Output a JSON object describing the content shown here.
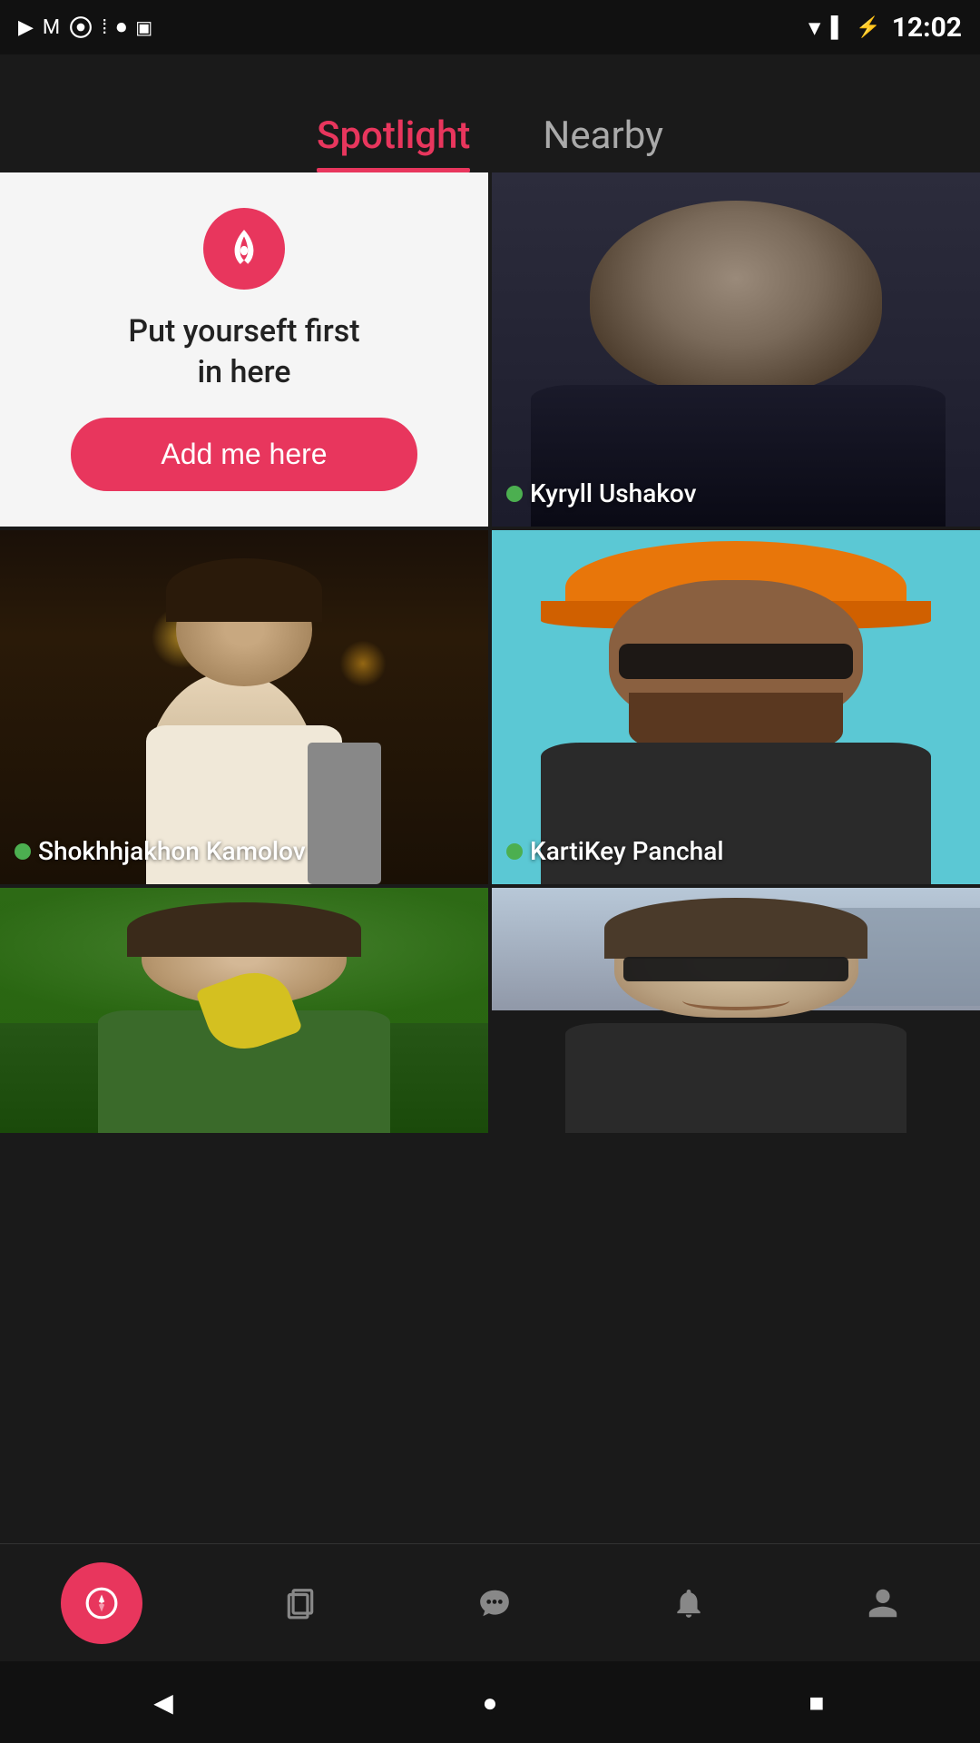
{
  "statusBar": {
    "time": "12:02",
    "icons": [
      "play-icon",
      "gmail-icon",
      "chrome-icon",
      "dots-icon",
      "record-icon",
      "nfc-icon"
    ]
  },
  "tabs": [
    {
      "id": "spotlight",
      "label": "Spotlight",
      "active": true
    },
    {
      "id": "nearby",
      "label": "Nearby",
      "active": false
    }
  ],
  "promoCard": {
    "title": "Put yourseft first\nin here",
    "buttonLabel": "Add me here",
    "rocketIcon": "rocket-icon"
  },
  "profiles": [
    {
      "id": "kyryll",
      "name": "Kyryll Ushakov",
      "online": true,
      "bgClass": "bg-kyryll"
    },
    {
      "id": "shokhj",
      "name": "Shokhhjakhon Kamolov",
      "online": true,
      "bgClass": "bg-shokhj"
    },
    {
      "id": "karti",
      "name": "KartiKey Panchal",
      "online": true,
      "bgClass": "bg-karti"
    },
    {
      "id": "bottom-left",
      "name": "",
      "online": false,
      "bgClass": "bg-bottom-left"
    },
    {
      "id": "bottom-right",
      "name": "",
      "online": false,
      "bgClass": "bg-bottom-right"
    }
  ],
  "bottomNav": [
    {
      "id": "discover",
      "icon": "compass-icon",
      "active": true
    },
    {
      "id": "cards",
      "icon": "cards-icon",
      "active": false
    },
    {
      "id": "chat",
      "icon": "chat-icon",
      "active": false
    },
    {
      "id": "notifications",
      "icon": "bell-icon",
      "active": false
    },
    {
      "id": "profile",
      "icon": "person-icon",
      "active": false
    }
  ],
  "systemNav": {
    "back": "◀",
    "home": "●",
    "recent": "■"
  }
}
